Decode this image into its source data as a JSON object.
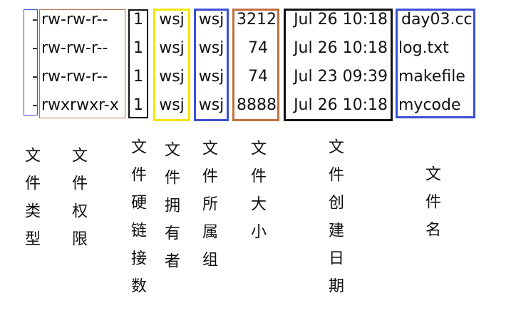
{
  "colors": {
    "type_box": "#3b4fd4",
    "perm_box": "#b5704a",
    "links_box": "#111111",
    "owner_box": "#f3e600",
    "group_box": "#3b4fd4",
    "size_box": "#c0703e",
    "date_box": "#111111",
    "name_box": "#3b4fd4"
  },
  "listing": {
    "type": [
      "-",
      "-",
      "-",
      "-"
    ],
    "perm": [
      "rw-rw-r--",
      "rw-rw-r--",
      "rw-rw-r--",
      "rwxrwxr-x"
    ],
    "links": [
      "1",
      "1",
      "1",
      "1"
    ],
    "owner": [
      "wsj",
      "wsj",
      "wsj",
      "wsj"
    ],
    "group": [
      "wsj",
      "wsj",
      "wsj",
      "wsj"
    ],
    "size": [
      "3212",
      "74",
      "74",
      "8888"
    ],
    "date": [
      "Jul 26 10:18",
      "Jul 26 10:18",
      "Jul 23 09:39",
      "Jul 26 10:18"
    ],
    "name": [
      "day03.cc",
      "log.txt",
      "makefile",
      "mycode"
    ]
  },
  "labels": {
    "type": "文件类型",
    "perm": "文件权限",
    "links": "文件硬链接数",
    "owner": "文件拥有者",
    "group": "文件所属组",
    "size": "文件大小",
    "date": "文件创建日期",
    "name": "文件名"
  }
}
